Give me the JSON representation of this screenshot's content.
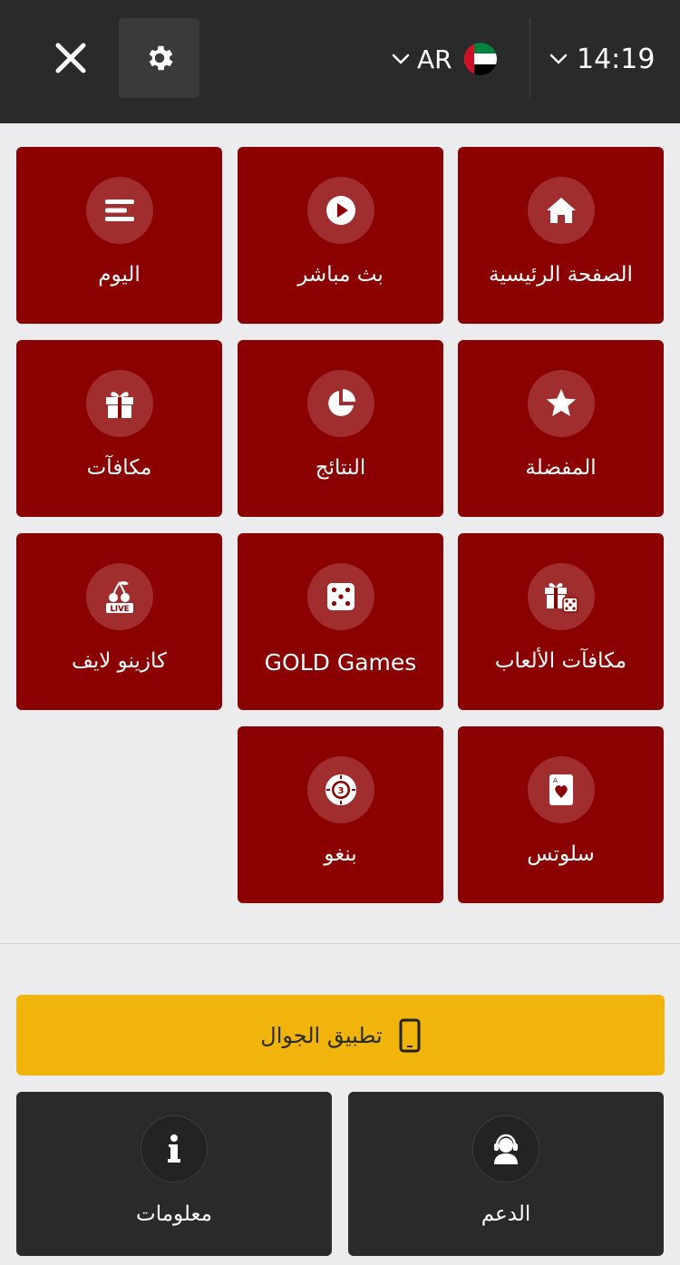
{
  "header": {
    "language": "AR",
    "time": "14:19",
    "flag": "uae-flag-icon"
  },
  "menu": {
    "home": "الصفحة الرئيسية",
    "live_stream": "بث مباشر",
    "today": "اليوم",
    "favorites": "المفضلة",
    "results": "النتائج",
    "bonuses": "مكافآت",
    "game_bonuses": "مكافآت الألعاب",
    "gold_games": "GOLD Games",
    "live_casino": "كازينو لايف",
    "slots": "سلوتس",
    "bingo": "بنغو"
  },
  "footer": {
    "mobile_app": "تطبيق الجوال",
    "support": "الدعم",
    "info": "معلومات"
  },
  "colors": {
    "tile": "#8b0000",
    "topbar": "#2a2a2a",
    "accent": "#f0b40a",
    "background": "#ececee"
  }
}
